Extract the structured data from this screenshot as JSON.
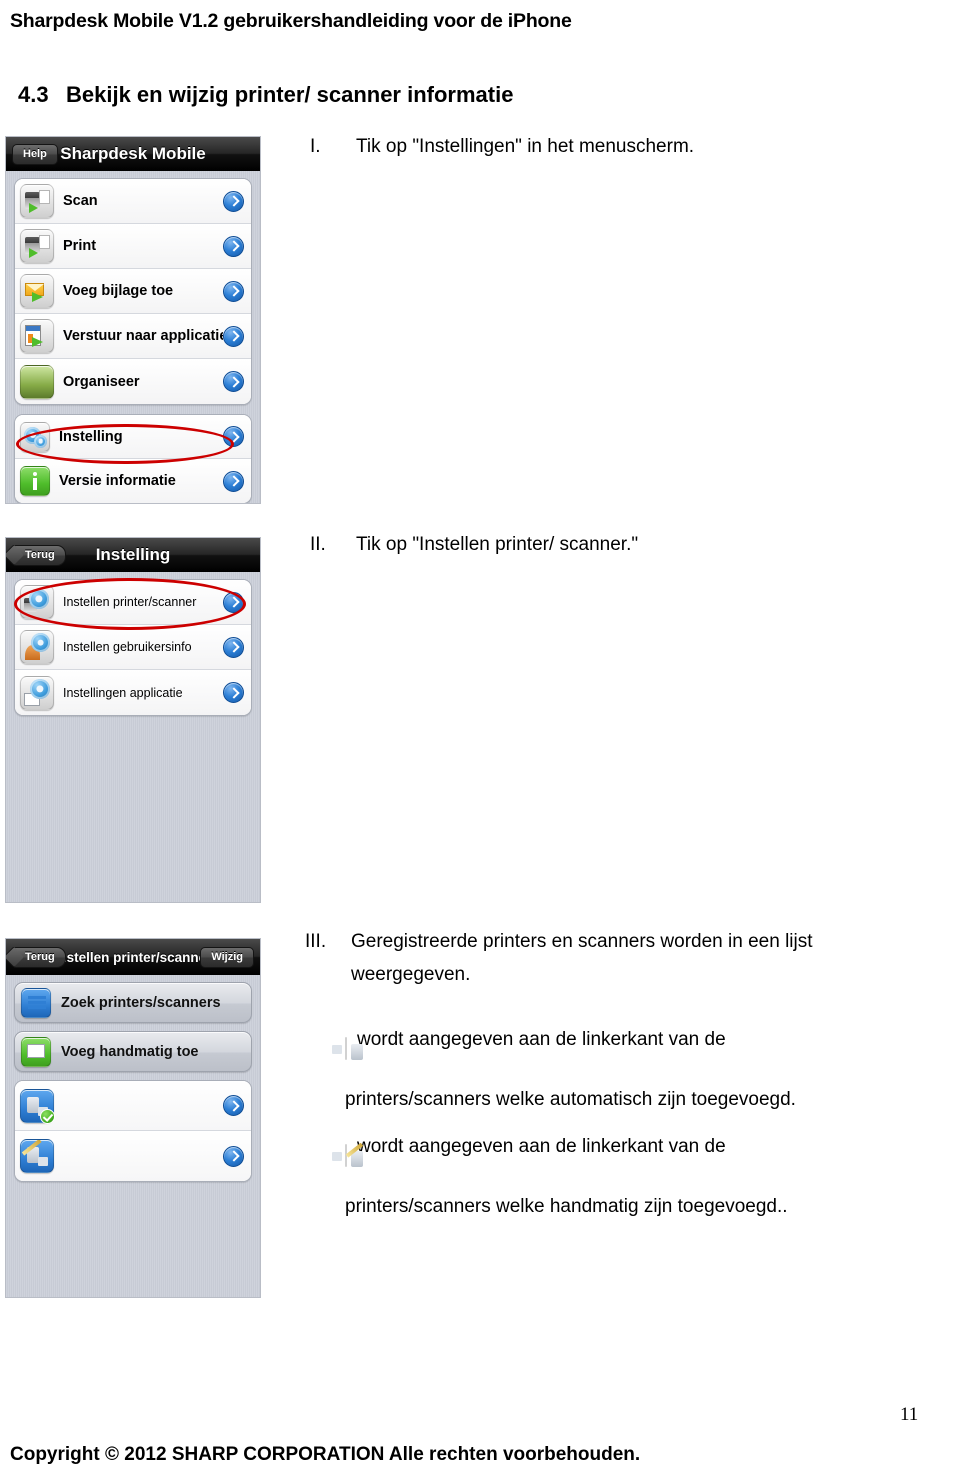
{
  "document": {
    "header": "Sharpdesk Mobile V1.2 gebruikershandleiding voor de iPhone",
    "section_number": "4.3",
    "section_title": "Bekijk en wijzig printer/ scanner informatie",
    "footer_copyright": "Copyright © 2012 SHARP CORPORATION Alle rechten voorbehouden.",
    "page_number": "11"
  },
  "steps": [
    {
      "roman": "I.",
      "text": "Tik op \"Instellingen\" in het menuscherm."
    },
    {
      "roman": "II.",
      "text": "Tik op \"Instellen printer/ scanner.\""
    },
    {
      "roman": "III.",
      "line1": "Geregistreerde printers en scanners worden in een lijst",
      "line2": "weergegeven."
    }
  ],
  "notes": [
    {
      "icon": "printer-auto-icon",
      "line1": "wordt aangegeven aan de linkerkant van de",
      "line2": "printers/scanners welke automatisch zijn toegevoegd."
    },
    {
      "icon": "printer-manual-icon",
      "line1": "wordt aangegeven aan de linkerkant van de",
      "line2": "printers/scanners welke handmatig zijn toegevoegd.."
    }
  ],
  "screenshots": {
    "menu": {
      "nav": {
        "left_button": "Help",
        "title": "Sharpdesk Mobile"
      },
      "group1": [
        {
          "icon": "scan-icon",
          "label": "Scan"
        },
        {
          "icon": "print-icon",
          "label": "Print"
        },
        {
          "icon": "attachment-icon",
          "label": "Voeg bijlage toe"
        },
        {
          "icon": "send-to-application-icon",
          "label": "Verstuur naar applicatie"
        },
        {
          "icon": "organise-icon",
          "label": "Organiseer"
        }
      ],
      "group2": [
        {
          "icon": "settings-icon",
          "label": "Instelling"
        },
        {
          "icon": "version-info-icon",
          "label": "Versie informatie"
        }
      ],
      "highlight": "Instelling"
    },
    "setting": {
      "nav": {
        "left_button": "Terug",
        "title": "Instelling"
      },
      "rows": [
        {
          "icon": "printer-settings-icon",
          "label": "Instellen printer/scanner"
        },
        {
          "icon": "user-settings-icon",
          "label": "Instellen gebruikersinfo"
        },
        {
          "icon": "application-settings-icon",
          "label": "Instellingen applicatie"
        }
      ],
      "highlight": "Instellen printer/scanner"
    },
    "printers": {
      "nav": {
        "left_button": "Terug",
        "title": "Instellen printer/scanner",
        "right_button": "Wijzig"
      },
      "actions": [
        {
          "icon": "search-printers-icon",
          "label": "Zoek printers/scanners"
        },
        {
          "icon": "add-manually-icon",
          "label": "Voeg handmatig toe"
        }
      ],
      "devices": [
        {
          "icon": "printer-auto-icon",
          "name": "",
          "detail": "",
          "redacted": true
        },
        {
          "icon": "printer-manual-icon",
          "name": "",
          "detail": "",
          "redacted": true
        }
      ]
    }
  },
  "colors": {
    "annotation": "#cc0000",
    "navbar": "#000000",
    "chevron": "#2c7fd6"
  }
}
